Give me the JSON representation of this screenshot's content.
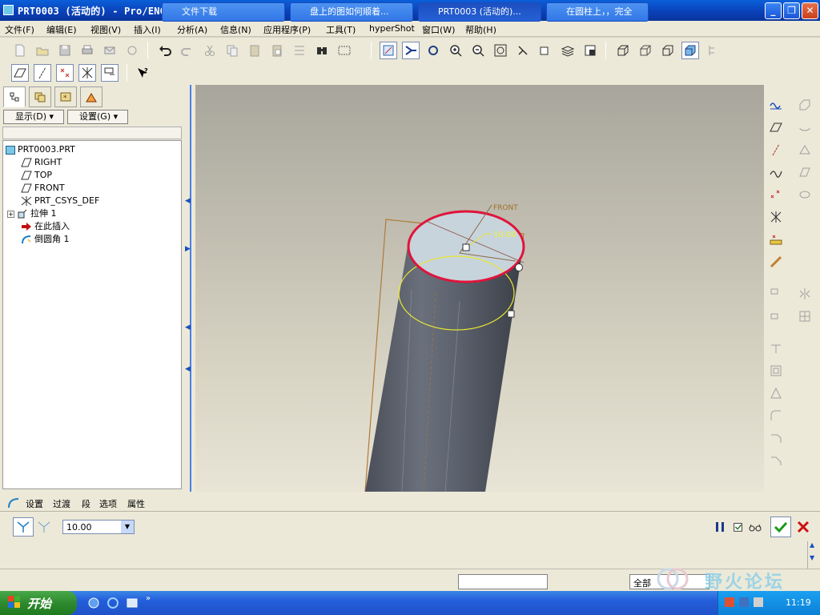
{
  "window": {
    "title": "PRT0003 (活动的) - Pro/ENGINEER Wildfire 4.0",
    "minimize": "_",
    "restore": "❐",
    "close": "✕"
  },
  "menu": [
    "文件(F)",
    "编辑(E)",
    "视图(V)",
    "插入(I)",
    "分析(A)",
    "信息(N)",
    "应用程序(P)",
    "工具(T)",
    "hyperShot",
    "窗口(W)",
    "帮助(H)"
  ],
  "nav": {
    "display_label": "显示(D)",
    "settings_label": "设置(G)"
  },
  "tree": {
    "root": "PRT0003.PRT",
    "items": [
      "RIGHT",
      "TOP",
      "FRONT",
      "PRT_CSYS_DEF",
      "拉伸 1",
      "在此插入",
      "倒圆角 1"
    ]
  },
  "viewport": {
    "datum_label": "FRONT",
    "dimension": "10.00",
    "edge_color": "#e0143c",
    "preview_color": "#e8e830"
  },
  "dashboard": {
    "tabs": [
      "设置",
      "过渡",
      "段",
      "选项",
      "属性"
    ],
    "radius_value": "10.00"
  },
  "status": {
    "filter_value": "全部"
  },
  "watermark": {
    "text": "野火论坛"
  },
  "taskbar": {
    "start": "开始",
    "tasks": [
      "文件下载",
      "盘上的图如何顺着...",
      "PRT0003 (活动的)...",
      "在圆柱上，，完全"
    ],
    "clock": "11:19"
  },
  "colors": {
    "accent": "#0a3fb8",
    "confirm": "#1a9a1a",
    "cancel": "#cc1010"
  }
}
